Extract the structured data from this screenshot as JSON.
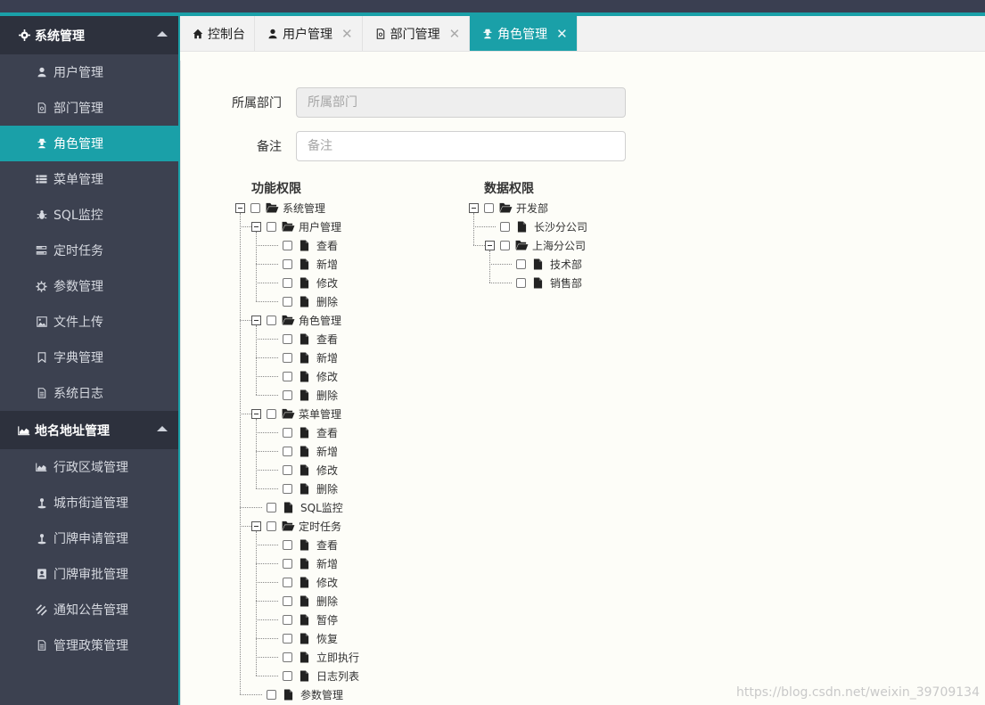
{
  "sidebar": {
    "groups": [
      {
        "label": "系统管理",
        "icon": "gear-icon",
        "items": [
          {
            "label": "用户管理",
            "icon": "user-icon"
          },
          {
            "label": "部门管理",
            "icon": "file-icon"
          },
          {
            "label": "角色管理",
            "icon": "user-secret-icon",
            "active": true
          },
          {
            "label": "菜单管理",
            "icon": "list-icon"
          },
          {
            "label": "SQL监控",
            "icon": "bug-icon"
          },
          {
            "label": "定时任务",
            "icon": "tasks-icon"
          },
          {
            "label": "参数管理",
            "icon": "cog-icon"
          },
          {
            "label": "文件上传",
            "icon": "image-icon"
          },
          {
            "label": "字典管理",
            "icon": "bookmark-icon"
          },
          {
            "label": "系统日志",
            "icon": "doc-icon"
          }
        ]
      },
      {
        "label": "地名地址管理",
        "icon": "area-chart-icon",
        "items": [
          {
            "label": "行政区域管理",
            "icon": "area-chart-icon"
          },
          {
            "label": "城市街道管理",
            "icon": "street-icon"
          },
          {
            "label": "门牌申请管理",
            "icon": "street-icon"
          },
          {
            "label": "门牌审批管理",
            "icon": "contact-icon"
          },
          {
            "label": "通知公告管理",
            "icon": "stripe-icon"
          },
          {
            "label": "管理政策管理",
            "icon": "doc-icon"
          }
        ]
      }
    ]
  },
  "tabs": [
    {
      "label": "控制台",
      "icon": "home-icon",
      "closable": false
    },
    {
      "label": "用户管理",
      "icon": "user-icon",
      "closable": true
    },
    {
      "label": "部门管理",
      "icon": "file-icon",
      "closable": true
    },
    {
      "label": "角色管理",
      "icon": "user-secret-icon",
      "closable": true,
      "active": true
    }
  ],
  "form": {
    "dept_label": "所属部门",
    "dept_placeholder": "所属部门",
    "remark_label": "备注",
    "remark_placeholder": "备注"
  },
  "func_tree": {
    "title": "功能权限",
    "nodes": [
      {
        "label": "系统管理",
        "level": 0,
        "folder": true
      },
      {
        "label": "用户管理",
        "level": 1,
        "folder": true
      },
      {
        "label": "查看",
        "level": 2
      },
      {
        "label": "新增",
        "level": 2
      },
      {
        "label": "修改",
        "level": 2
      },
      {
        "label": "删除",
        "level": 2
      },
      {
        "label": "角色管理",
        "level": 1,
        "folder": true
      },
      {
        "label": "查看",
        "level": 2
      },
      {
        "label": "新增",
        "level": 2
      },
      {
        "label": "修改",
        "level": 2
      },
      {
        "label": "删除",
        "level": 2
      },
      {
        "label": "菜单管理",
        "level": 1,
        "folder": true
      },
      {
        "label": "查看",
        "level": 2
      },
      {
        "label": "新增",
        "level": 2
      },
      {
        "label": "修改",
        "level": 2
      },
      {
        "label": "删除",
        "level": 2
      },
      {
        "label": "SQL监控",
        "level": 1
      },
      {
        "label": "定时任务",
        "level": 1,
        "folder": true
      },
      {
        "label": "查看",
        "level": 2
      },
      {
        "label": "新增",
        "level": 2
      },
      {
        "label": "修改",
        "level": 2
      },
      {
        "label": "删除",
        "level": 2
      },
      {
        "label": "暂停",
        "level": 2
      },
      {
        "label": "恢复",
        "level": 2
      },
      {
        "label": "立即执行",
        "level": 2
      },
      {
        "label": "日志列表",
        "level": 2
      },
      {
        "label": "参数管理",
        "level": 1
      }
    ]
  },
  "data_tree": {
    "title": "数据权限",
    "nodes": [
      {
        "label": "开发部",
        "level": 0,
        "folder": true
      },
      {
        "label": "长沙分公司",
        "level": 1
      },
      {
        "label": "上海分公司",
        "level": 1,
        "folder": true
      },
      {
        "label": "技术部",
        "level": 2
      },
      {
        "label": "销售部",
        "level": 2
      }
    ]
  },
  "watermark": "https://blog.csdn.net/weixin_39709134",
  "colors": {
    "accent": "#1aa0a8",
    "sidebar": "#3c4150",
    "sidebar_header": "#2d313d"
  }
}
